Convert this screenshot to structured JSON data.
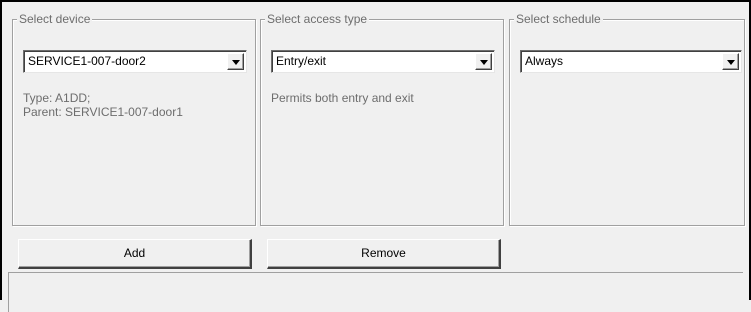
{
  "device_group": {
    "legend": "Select device",
    "combo_value": "SERVICE1-007-door2",
    "info_line1": "Type: A1DD;",
    "info_line2": "Parent: SERVICE1-007-door1"
  },
  "access_group": {
    "legend": "Select access type",
    "combo_value": "Entry/exit",
    "info_line1": "Permits both entry and exit"
  },
  "schedule_group": {
    "legend": "Select schedule",
    "combo_value": "Always"
  },
  "buttons": {
    "add_label": "Add",
    "remove_label": "Remove"
  },
  "icons": {
    "dropdown": "chevron-down-icon"
  },
  "colors": {
    "background": "#f0f0f0",
    "group_border": "#a0a0a0",
    "label_text": "#6d6d6d"
  }
}
